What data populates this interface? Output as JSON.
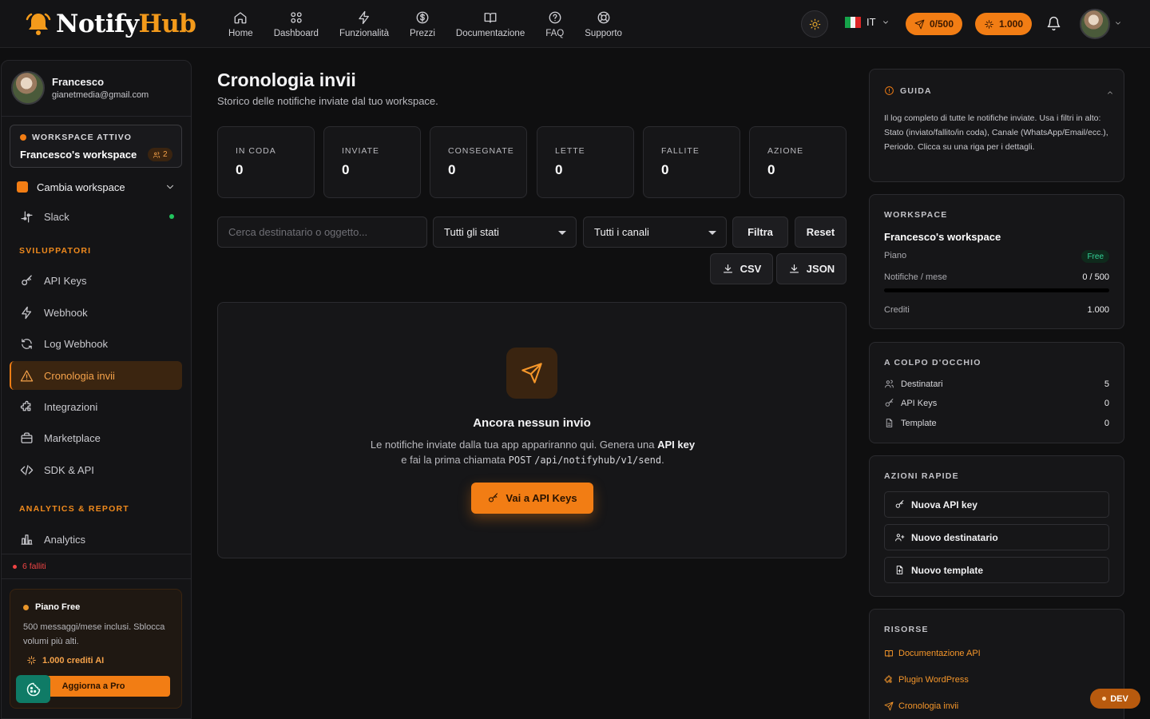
{
  "app": {
    "logo_notify": "Notify",
    "logo_hub": "Hub"
  },
  "nav": [
    {
      "label": "Home",
      "icon": "home-icon"
    },
    {
      "label": "Dashboard",
      "icon": "grid-icon"
    },
    {
      "label": "Funzionalità",
      "icon": "bolt-icon"
    },
    {
      "label": "Prezzi",
      "icon": "dollar-icon"
    },
    {
      "label": "Documentazione",
      "icon": "book-icon"
    },
    {
      "label": "FAQ",
      "icon": "help-icon"
    },
    {
      "label": "Supporto",
      "icon": "lifebuoy-icon"
    }
  ],
  "header": {
    "language": "IT",
    "messages_pill": "0/500",
    "credits_pill": "1.000"
  },
  "colors": {
    "accent": "#f27d14",
    "background": "#0f0f10",
    "panel": "#161618",
    "success": "#22c55e",
    "danger": "#ef4444"
  },
  "sidebar": {
    "user_name": "Francesco",
    "user_email": "gianetmedia@gmail.com",
    "workspace_label": "WORKSPACE ATTIVO",
    "workspace_name": "Francesco's workspace",
    "workspace_members": "2",
    "switch_label": "Cambia workspace",
    "slack_label": "Slack",
    "dev_section": "SVILUPPATORI",
    "dev_items": [
      {
        "label": "API Keys",
        "icon": "key-icon"
      },
      {
        "label": "Webhook",
        "icon": "bolt-icon"
      },
      {
        "label": "Log Webhook",
        "icon": "refresh-icon"
      },
      {
        "label": "Cronologia invii",
        "icon": "warning-icon"
      },
      {
        "label": "Integrazioni",
        "icon": "puzzle-icon"
      },
      {
        "label": "Marketplace",
        "icon": "briefcase-icon"
      },
      {
        "label": "SDK & API",
        "icon": "code-icon"
      }
    ],
    "analytics_section": "ANALYTICS & REPORT",
    "analytics_label": "Analytics",
    "failed_text": "6 falliti",
    "plan_title": "Piano Free",
    "plan_desc": "500 messaggi/mese inclusi. Sblocca volumi più alti.",
    "plan_credits": "1.000 crediti AI",
    "upgrade_label": "Aggiorna a Pro"
  },
  "main": {
    "title": "Cronologia invii",
    "subtitle": "Storico delle notifiche inviate dal tuo workspace.",
    "stats": [
      {
        "label": "IN CODA",
        "value": "0"
      },
      {
        "label": "INVIATE",
        "value": "0"
      },
      {
        "label": "CONSEGNATE",
        "value": "0"
      },
      {
        "label": "LETTE",
        "value": "0"
      },
      {
        "label": "FALLITE",
        "value": "0"
      },
      {
        "label": "AZIONE",
        "value": "0"
      }
    ],
    "search_placeholder": "Cerca destinatario o oggetto...",
    "status_select": "Tutti gli stati",
    "channel_select": "Tutti i canali",
    "filter_label": "Filtra",
    "reset_label": "Reset",
    "csv_label": "CSV",
    "json_label": "JSON",
    "empty_title": "Ancora nessun invio",
    "empty_text_1": "Le notifiche inviate dalla tua app appariranno qui. Genera una",
    "empty_text_bold": "API key",
    "empty_text_2": "e fai la prima chiamata",
    "empty_text_method": "POST",
    "empty_text_code": "/api/notifyhub/v1/send",
    "empty_text_end": ".",
    "empty_button": "Vai a API Keys"
  },
  "guide": {
    "title": "GUIDA",
    "text": "Il log completo di tutte le notifiche inviate. Usa i filtri in alto: Stato (inviato/fallito/in coda), Canale (WhatsApp/Email/ecc.), Periodo. Clicca su una riga per i dettagli."
  },
  "workspace_panel": {
    "title": "WORKSPACE",
    "name": "Francesco's workspace",
    "plan_label": "Piano",
    "plan_value": "Free",
    "notif_label": "Notifiche / mese",
    "notif_value": "0 / 500",
    "notif_fraction": 0,
    "credits_label": "Crediti",
    "credits_value": "1.000"
  },
  "glance": {
    "title": "A COLPO D'OCCHIO",
    "rows": [
      {
        "label": "Destinatari",
        "value": "5",
        "icon": "users-icon"
      },
      {
        "label": "API Keys",
        "value": "0",
        "icon": "key-icon"
      },
      {
        "label": "Template",
        "value": "0",
        "icon": "file-icon"
      }
    ]
  },
  "quick": {
    "title": "AZIONI RAPIDE",
    "buttons": [
      "Nuova API key",
      "Nuovo destinatario",
      "Nuovo template"
    ]
  },
  "resources": {
    "title": "RISORSE",
    "links": [
      "Documentazione API",
      "Plugin WordPress",
      "Cronologia invii"
    ]
  },
  "dev_badge": "DEV"
}
